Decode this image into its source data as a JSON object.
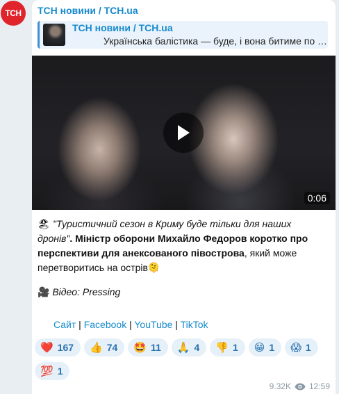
{
  "avatar": {
    "text": "TCH"
  },
  "channel": {
    "name": "ТСН новини / TCH.ua"
  },
  "forward": {
    "name": "ТСН новини / TCH.ua",
    "text": "Українська балістика — буде, і вона битиме по …"
  },
  "video": {
    "duration": "0:06"
  },
  "caption": {
    "emoji_beach": "🏖",
    "quote": "\"Туристичний сезон в Криму буде тільки для наших дронів\"",
    "bold": ". Міністр оборони Михайло Федоров коротко про перспективи для анексованого півострова",
    "rest": ", який може перетворитись на острів",
    "emoji_end": "🫠",
    "emoji_camera": "🎥",
    "source": "Відео: Pressing"
  },
  "links": {
    "site": "Сайт",
    "facebook": "Facebook",
    "youtube": "YouTube",
    "tiktok": "TikTok",
    "sep": " | "
  },
  "reactions": [
    {
      "emoji": "❤️",
      "count": "167"
    },
    {
      "emoji": "👍",
      "count": "74"
    },
    {
      "emoji": "🤩",
      "count": "11"
    },
    {
      "emoji": "🙏",
      "count": "4"
    },
    {
      "emoji": "👎",
      "count": "1"
    },
    {
      "emoji": "😁",
      "count": "1"
    },
    {
      "emoji": "😱",
      "count": "1"
    },
    {
      "emoji": "💯",
      "count": "1"
    }
  ],
  "meta": {
    "views": "9.32K",
    "time": "12:59"
  }
}
